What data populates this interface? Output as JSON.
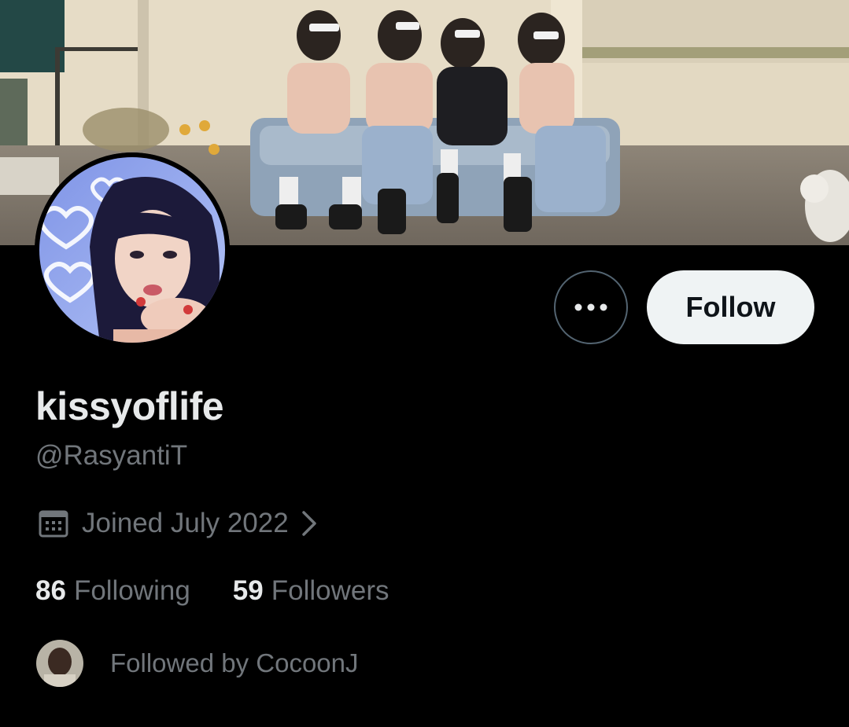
{
  "profile": {
    "display_name": "kissyoflife",
    "handle": "@RasyantiT",
    "joined": "Joined July 2022",
    "following_count": "86",
    "following_label": "Following",
    "followers_count": "59",
    "followers_label": "Followers",
    "followed_by": "Followed by CocoonJ"
  },
  "actions": {
    "follow_label": "Follow"
  },
  "icons": {
    "more": "more-horizontal-icon",
    "calendar": "calendar-icon",
    "chevron": "chevron-right-icon"
  },
  "colors": {
    "background": "#000000",
    "primary_text": "#e7e9ea",
    "secondary_text": "#71767b",
    "follow_button_bg": "#eff3f4",
    "follow_button_text": "#0f1419",
    "border": "#536471"
  }
}
